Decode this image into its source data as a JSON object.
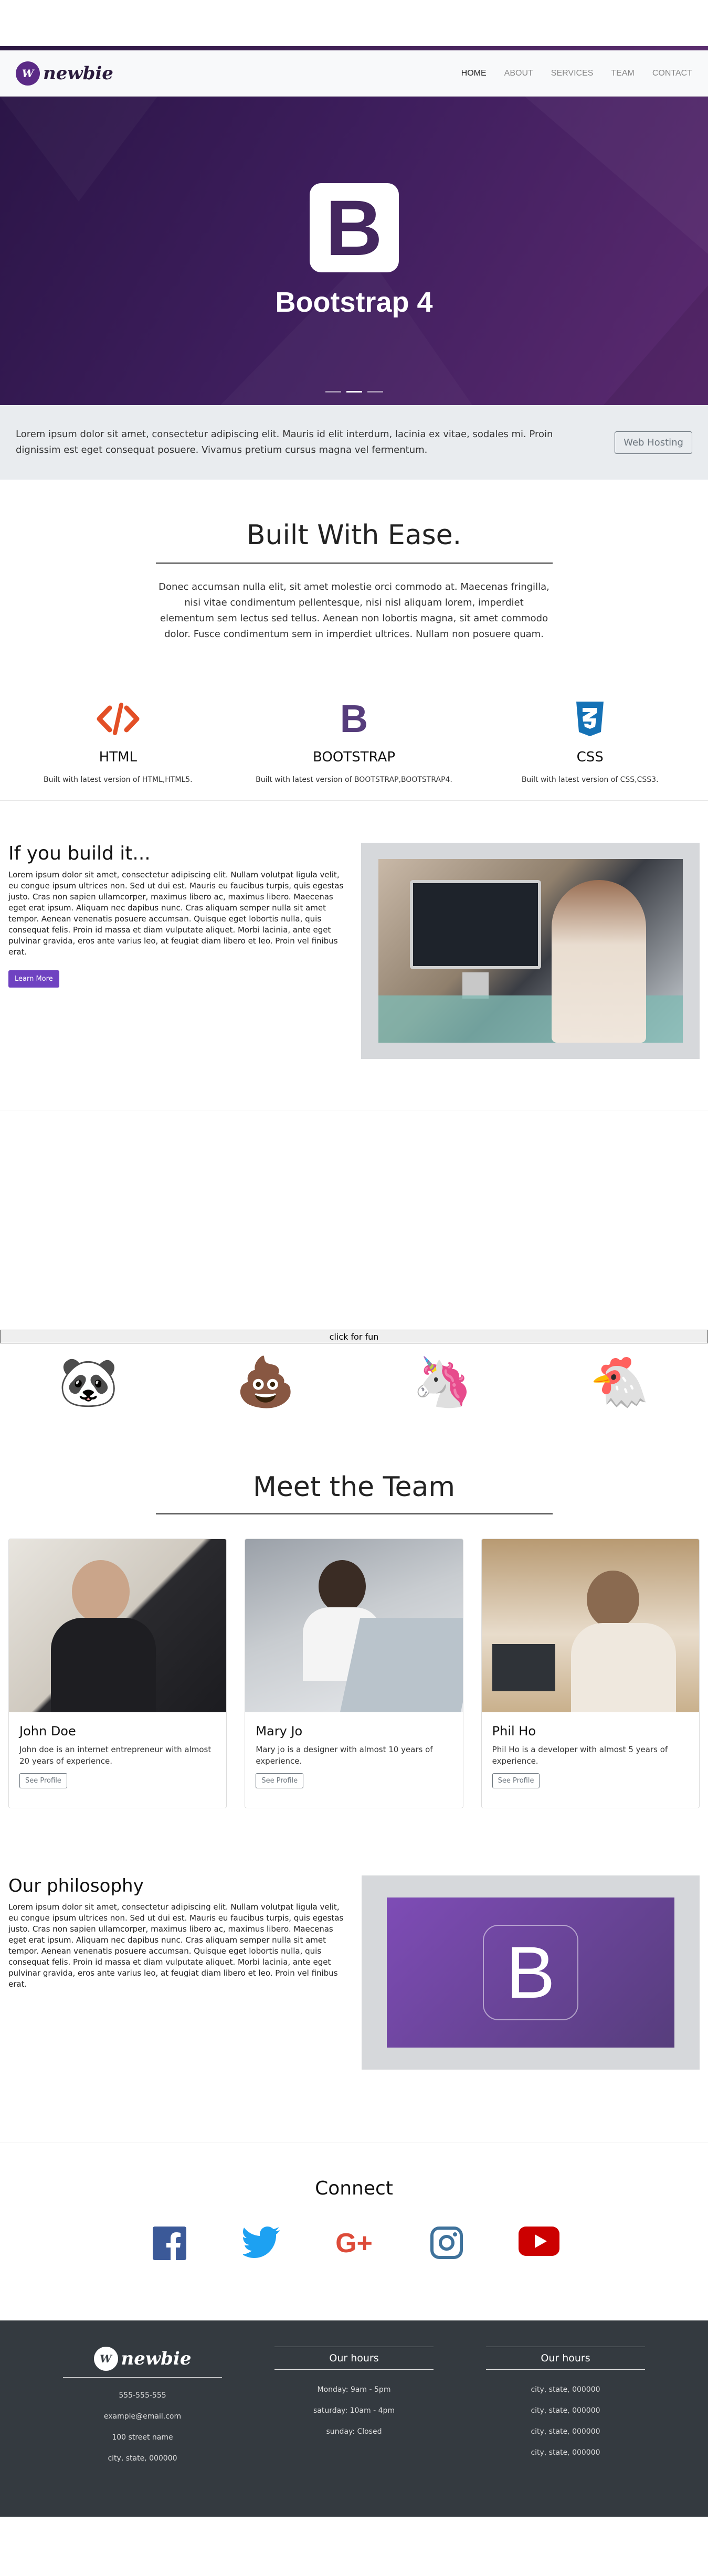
{
  "nav": {
    "logo_badge": "W",
    "logo_text": "newbie",
    "links": [
      "HOME",
      "ABOUT",
      "SERVICES",
      "TEAM",
      "CONTACT"
    ]
  },
  "hero": {
    "tile_letter": "B",
    "title": "Bootstrap 4"
  },
  "jumbotron": {
    "text": "Lorem ipsum dolor sit amet, consectetur adipiscing elit. Mauris id elit interdum, lacinia ex vitae, sodales mi. Proin dignissim est eget consequat posuere. Vivamus pretium cursus magna vel fermentum.",
    "button": "Web Hosting"
  },
  "built": {
    "title": "Built With Ease.",
    "text": "Donec accumsan nulla elit, sit amet molestie orci commodo at. Maecenas fringilla, nisi vitae condimentum pellentesque, nisi nisl aliquam lorem, imperdiet elementum sem lectus sed tellus. Aenean non lobortis magna, sit amet commodo dolor. Fusce condimentum sem in imperdiet ultrices. Nullam non posuere quam.",
    "features": [
      {
        "icon": "html5-code-icon",
        "title": "HTML",
        "text": "Built with latest version of HTML,HTML5."
      },
      {
        "icon": "bootstrap-icon",
        "title": "BOOTSTRAP",
        "text": "Built with latest version of BOOTSTRAP,BOOTSTRAP4."
      },
      {
        "icon": "css3-icon",
        "title": "CSS",
        "text": "Built with latest version of CSS,CSS3."
      }
    ],
    "colors": {
      "html": "#e34f26",
      "bootstrap": "#563d7c",
      "css": "#1572b6"
    }
  },
  "build": {
    "title": "If you build it...",
    "text": "Lorem ipsum dolor sit amet, consectetur adipiscing elit. Nullam volutpat ligula velit, eu congue ipsum ultrices non. Sed ut dui est. Mauris eu faucibus turpis, quis egestas justo. Cras non sapien ullamcorper, maximus libero ac, maximus libero. Maecenas eget erat ipsum. Aliquam nec dapibus nunc. Cras aliquam semper nulla sit amet tempor. Aenean venenatis posuere accumsan. Quisque eget lobortis nulla, quis consequat felis. Proin id massa et diam vulputate aliquet. Morbi lacinia, ante eget pulvinar gravida, eros ante varius leo, at feugiat diam libero et leo. Proin vel finibus erat.",
    "button": "Learn More"
  },
  "fun": {
    "button": "click for fun",
    "emojis": [
      "🐼",
      "💩",
      "🦄",
      "🐔"
    ]
  },
  "team": {
    "title": "Meet the Team",
    "members": [
      {
        "name": "John Doe",
        "bio": "John doe is an internet entrepreneur with almost 20 years of experience.",
        "button": "See Profile"
      },
      {
        "name": "Mary Jo",
        "bio": "Mary jo is a designer with almost 10 years of experience.",
        "button": "See Profile"
      },
      {
        "name": "Phil Ho",
        "bio": "Phil Ho is a developer with almost 5 years of experience.",
        "button": "See Profile"
      }
    ]
  },
  "philosophy": {
    "title": "Our philosophy",
    "text": "Lorem ipsum dolor sit amet, consectetur adipiscing elit. Nullam volutpat ligula velit, eu congue ipsum ultrices non. Sed ut dui est. Mauris eu faucibus turpis, quis egestas justo. Cras non sapien ullamcorper, maximus libero ac, maximus libero. Maecenas eget erat ipsum. Aliquam nec dapibus nunc. Cras aliquam semper nulla sit amet tempor. Aenean venenatis posuere accumsan. Quisque eget lobortis nulla, quis consequat felis. Proin id massa et diam vulputate aliquet. Morbi lacinia, ante eget pulvinar gravida, eros ante varius leo, at feugiat diam libero et leo. Proin vel finibus erat.",
    "logo_letter": "B"
  },
  "connect": {
    "title": "Connect",
    "icons": [
      "facebook-icon",
      "twitter-icon",
      "google-plus-icon",
      "instagram-icon",
      "youtube-icon"
    ],
    "colors": {
      "facebook": "#3b5998",
      "twitter": "#1da1f2",
      "google": "#dd4b39",
      "instagram": "#3f729b",
      "youtube": "#cc0000"
    }
  },
  "footer": {
    "logo_badge": "W",
    "logo_text": "newbie",
    "contact": [
      "555-555-555",
      "example@email.com",
      "100 street name",
      "city, state, 000000"
    ],
    "hours_title": "Our hours",
    "hours": [
      "Monday: 9am - 5pm",
      "saturday: 10am - 4pm",
      "sunday: Closed"
    ],
    "col3_title": "Our hours",
    "col3": [
      "city, state, 000000",
      "city, state, 000000",
      "city, state, 000000",
      "city, state, 000000"
    ]
  }
}
